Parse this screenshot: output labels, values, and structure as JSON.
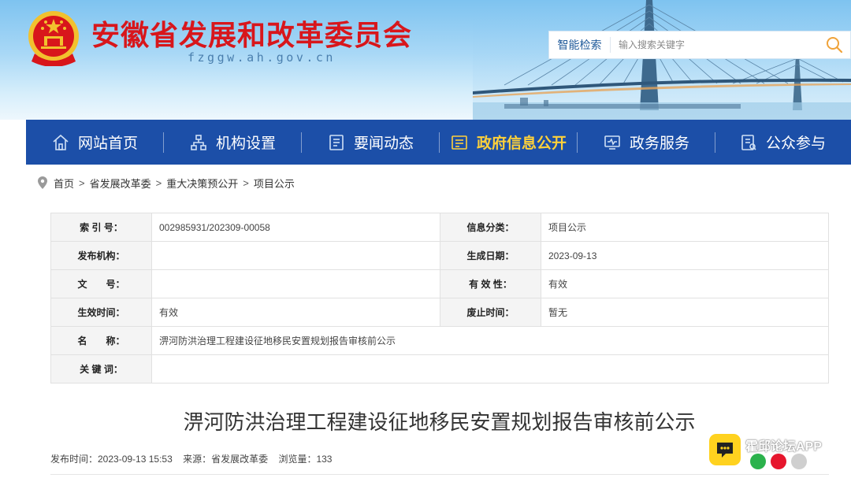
{
  "header": {
    "site_title": "安徽省发展和改革委员会",
    "site_domain": "fzggw.ah.gov.cn",
    "search_type": "智能检索",
    "search_placeholder": "输入搜索关键字"
  },
  "nav": [
    {
      "label": "网站首页",
      "icon": "home-icon"
    },
    {
      "label": "机构设置",
      "icon": "org-icon"
    },
    {
      "label": "要闻动态",
      "icon": "news-icon"
    },
    {
      "label": "政府信息公开",
      "icon": "disclosure-icon",
      "active": true
    },
    {
      "label": "政务服务",
      "icon": "service-icon"
    },
    {
      "label": "公众参与",
      "icon": "participate-icon"
    }
  ],
  "breadcrumb": [
    "首页",
    "省发展改革委",
    "重大决策预公开",
    "项目公示"
  ],
  "info": {
    "index_label": "索 引 号：",
    "index_value": "002985931/202309-00058",
    "category_label": "信息分类：",
    "category_value": "项目公示",
    "publisher_label": "发布机构：",
    "publisher_value": "",
    "created_label": "生成日期：",
    "created_value": "2023-09-13",
    "docno_label": "文　　号：",
    "docno_value": "",
    "validity_label": "有 效 性：",
    "validity_value": "有效",
    "effective_label": "生效时间：",
    "effective_value": "有效",
    "repeal_label": "废止时间：",
    "repeal_value": "暂无",
    "name_label": "名　　称：",
    "name_value": "淠河防洪治理工程建设征地移民安置规划报告审核前公示",
    "keywords_label": "关 键 词：",
    "keywords_value": ""
  },
  "article": {
    "title": "淠河防洪治理工程建设征地移民安置规划报告审核前公示",
    "publish_time": "发布时间：2023-09-13 15:53",
    "source": "来源：省发展改革委",
    "views": "浏览量：133"
  },
  "watermark": {
    "text": "霍邱论坛APP"
  },
  "colors": {
    "title_red": "#d8161b",
    "nav_blue": "#1c4fa8",
    "nav_active": "#ffd13a"
  }
}
